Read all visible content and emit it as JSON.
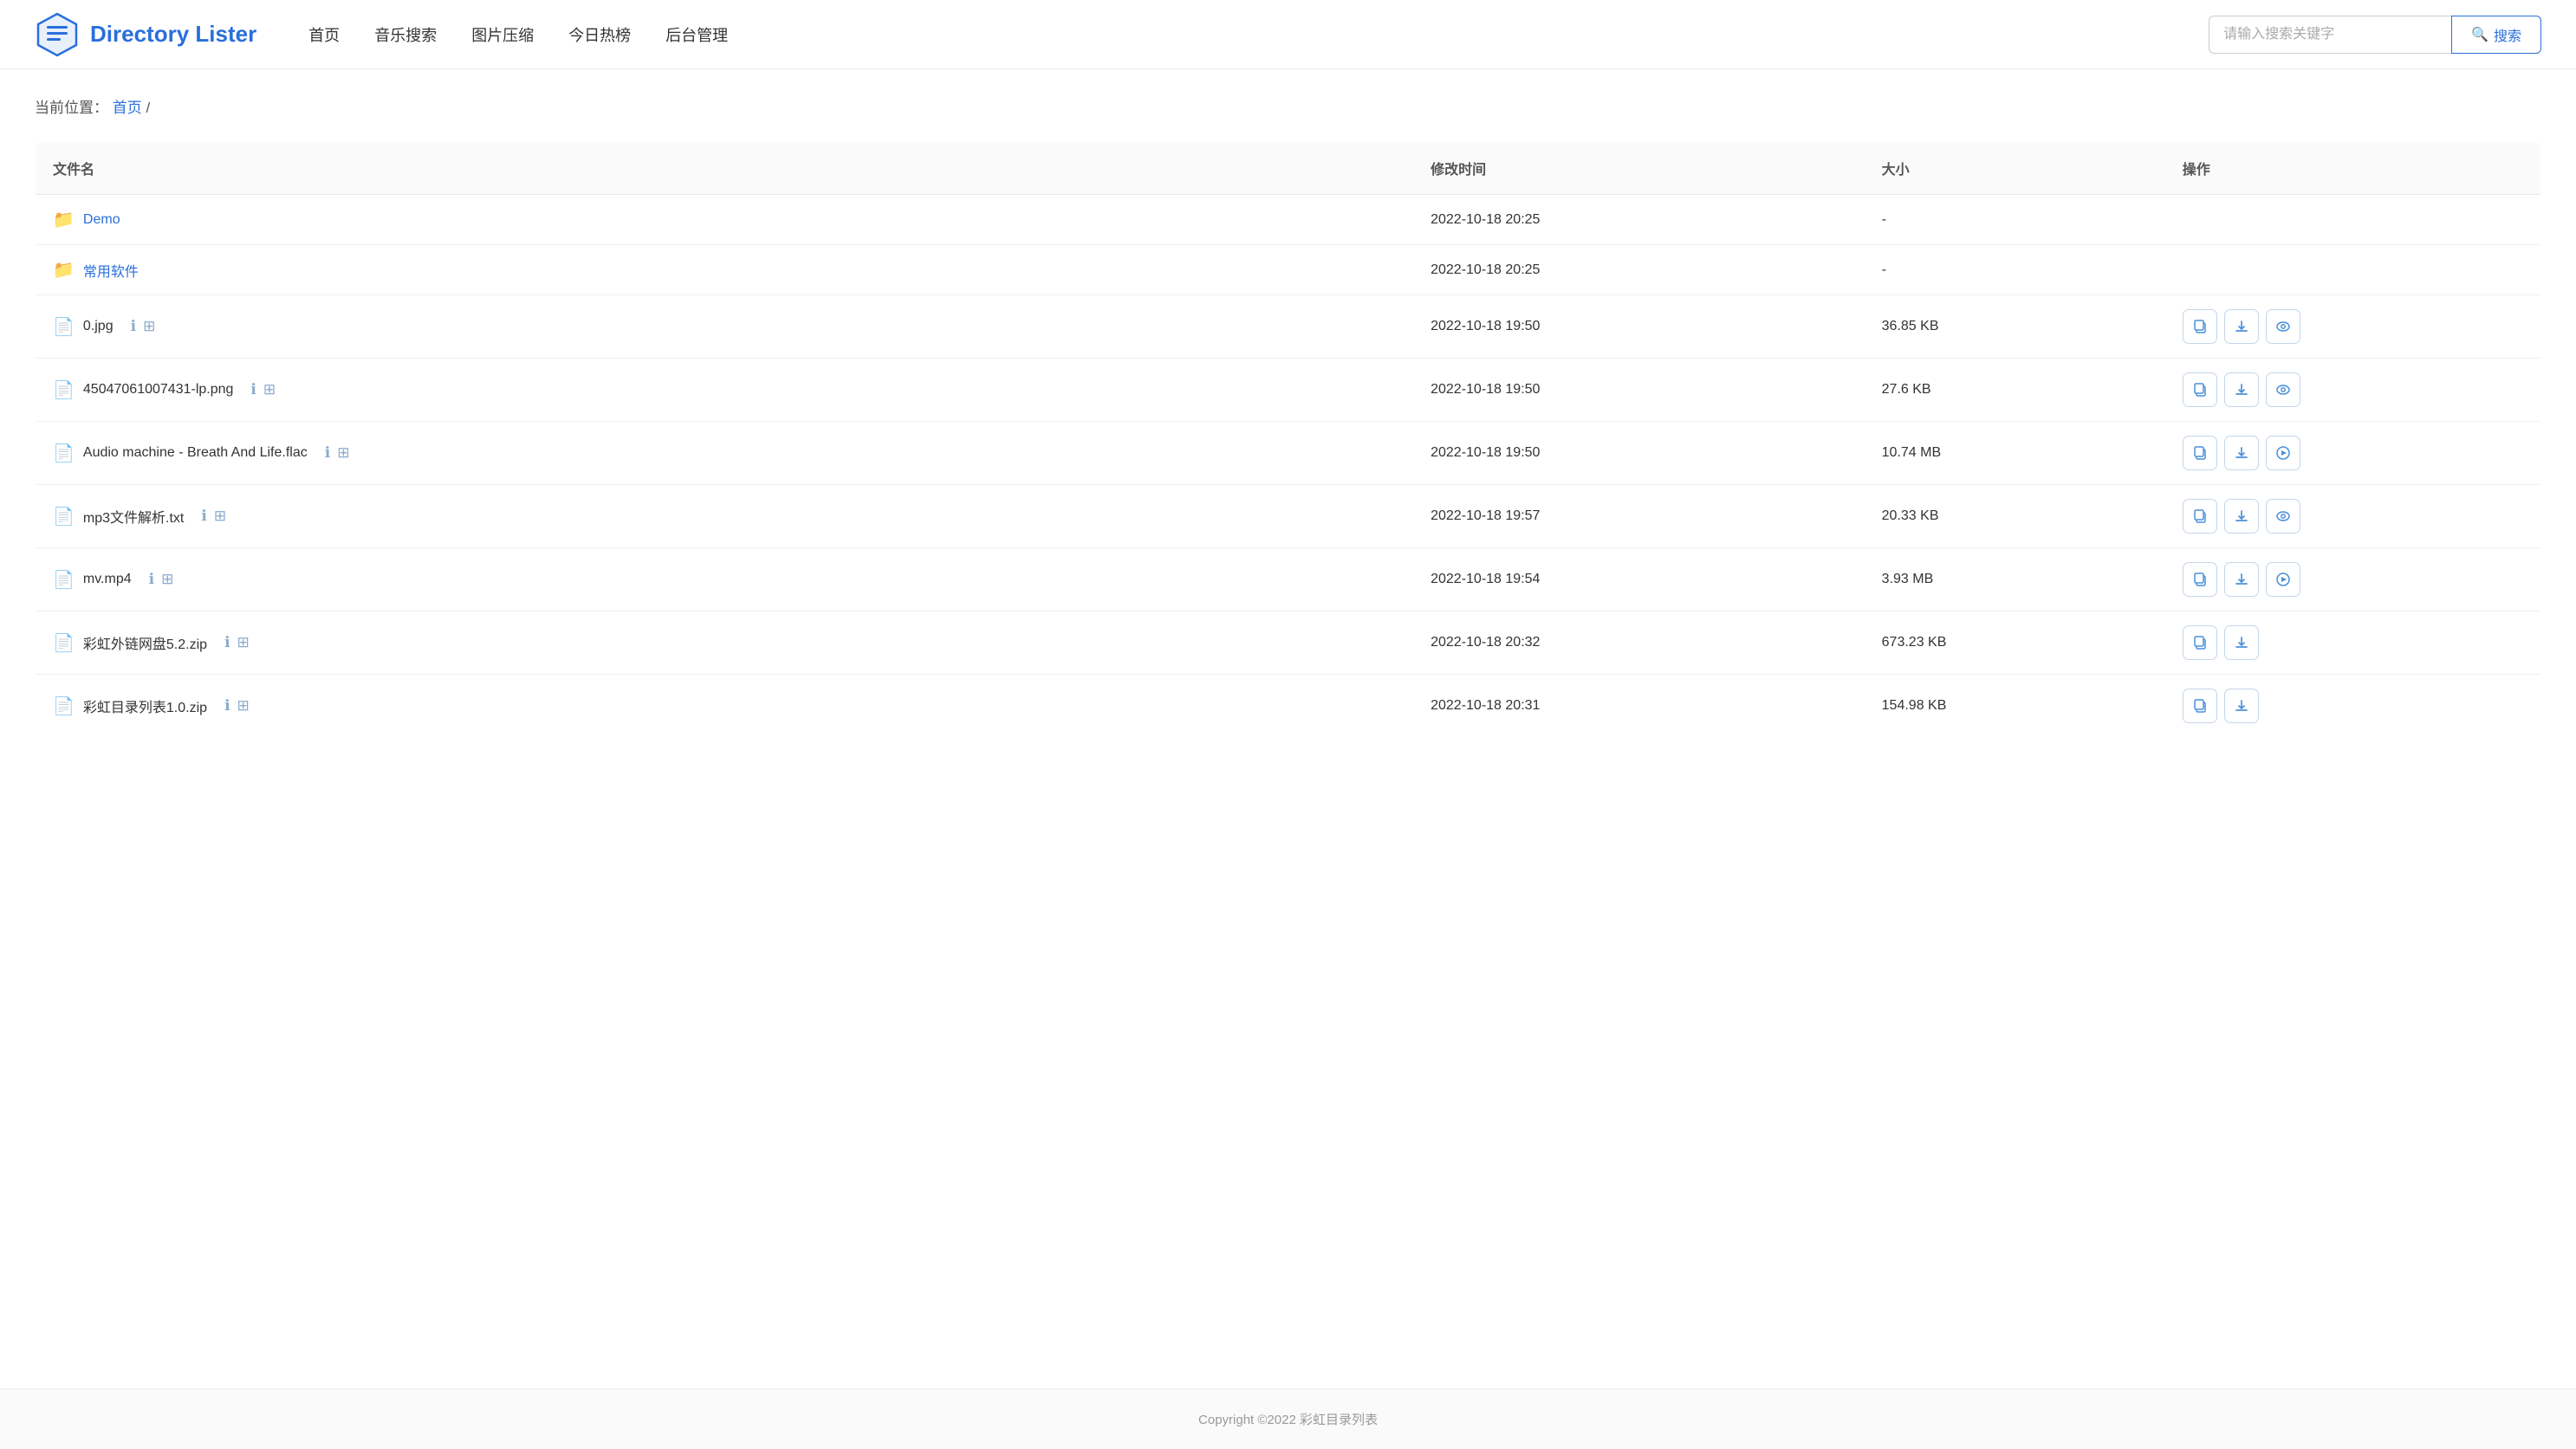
{
  "app": {
    "title": "Directory Lister",
    "logo_alt": "Directory Lister Logo"
  },
  "nav": {
    "items": [
      {
        "label": "首页",
        "key": "home"
      },
      {
        "label": "音乐搜索",
        "key": "music"
      },
      {
        "label": "图片压缩",
        "key": "image"
      },
      {
        "label": "今日热榜",
        "key": "hot"
      },
      {
        "label": "后台管理",
        "key": "admin"
      }
    ]
  },
  "search": {
    "placeholder": "请输入搜索关键字",
    "button_label": "搜索"
  },
  "breadcrumb": {
    "prefix": "当前位置：",
    "home_link": "首页",
    "separator": " /"
  },
  "table": {
    "col_name": "文件名",
    "col_time": "修改时间",
    "col_size": "大小",
    "col_ops": "操作",
    "rows": [
      {
        "type": "folder",
        "name": "Demo",
        "time": "2022-10-18 20:25",
        "size": "-",
        "has_info": false,
        "has_qr": false,
        "ops": []
      },
      {
        "type": "folder",
        "name": "常用软件",
        "time": "2022-10-18 20:25",
        "size": "-",
        "has_info": false,
        "has_qr": false,
        "ops": []
      },
      {
        "type": "file",
        "name": "0.jpg",
        "time": "2022-10-18 19:50",
        "size": "36.85 KB",
        "has_info": true,
        "has_qr": true,
        "ops": [
          "copy",
          "download",
          "eye"
        ]
      },
      {
        "type": "file",
        "name": "45047061007431-lp.png",
        "time": "2022-10-18 19:50",
        "size": "27.6 KB",
        "has_info": true,
        "has_qr": true,
        "ops": [
          "copy",
          "download",
          "eye"
        ]
      },
      {
        "type": "file",
        "name": "Audio machine - Breath And Life.flac",
        "time": "2022-10-18 19:50",
        "size": "10.74 MB",
        "has_info": true,
        "has_qr": true,
        "ops": [
          "copy",
          "download",
          "play"
        ]
      },
      {
        "type": "file",
        "name": "mp3文件解析.txt",
        "time": "2022-10-18 19:57",
        "size": "20.33 KB",
        "has_info": true,
        "has_qr": true,
        "ops": [
          "copy",
          "download",
          "eye"
        ]
      },
      {
        "type": "file",
        "name": "mv.mp4",
        "time": "2022-10-18 19:54",
        "size": "3.93 MB",
        "has_info": true,
        "has_qr": true,
        "ops": [
          "copy",
          "download",
          "play"
        ]
      },
      {
        "type": "file",
        "name": "彩虹外链网盘5.2.zip",
        "time": "2022-10-18 20:32",
        "size": "673.23 KB",
        "has_info": true,
        "has_qr": true,
        "ops": [
          "copy",
          "download"
        ]
      },
      {
        "type": "file",
        "name": "彩虹目录列表1.0.zip",
        "time": "2022-10-18 20:31",
        "size": "154.98 KB",
        "has_info": true,
        "has_qr": true,
        "ops": [
          "copy",
          "download"
        ]
      }
    ]
  },
  "footer": {
    "text": "Copyright ©2022 彩虹目录列表"
  },
  "icons": {
    "folder": "📁",
    "file": "📄",
    "search": "🔍",
    "copy": "⧉",
    "download": "⬇",
    "eye": "👁",
    "play": "▶",
    "info": "ℹ",
    "qr": "⊞"
  }
}
